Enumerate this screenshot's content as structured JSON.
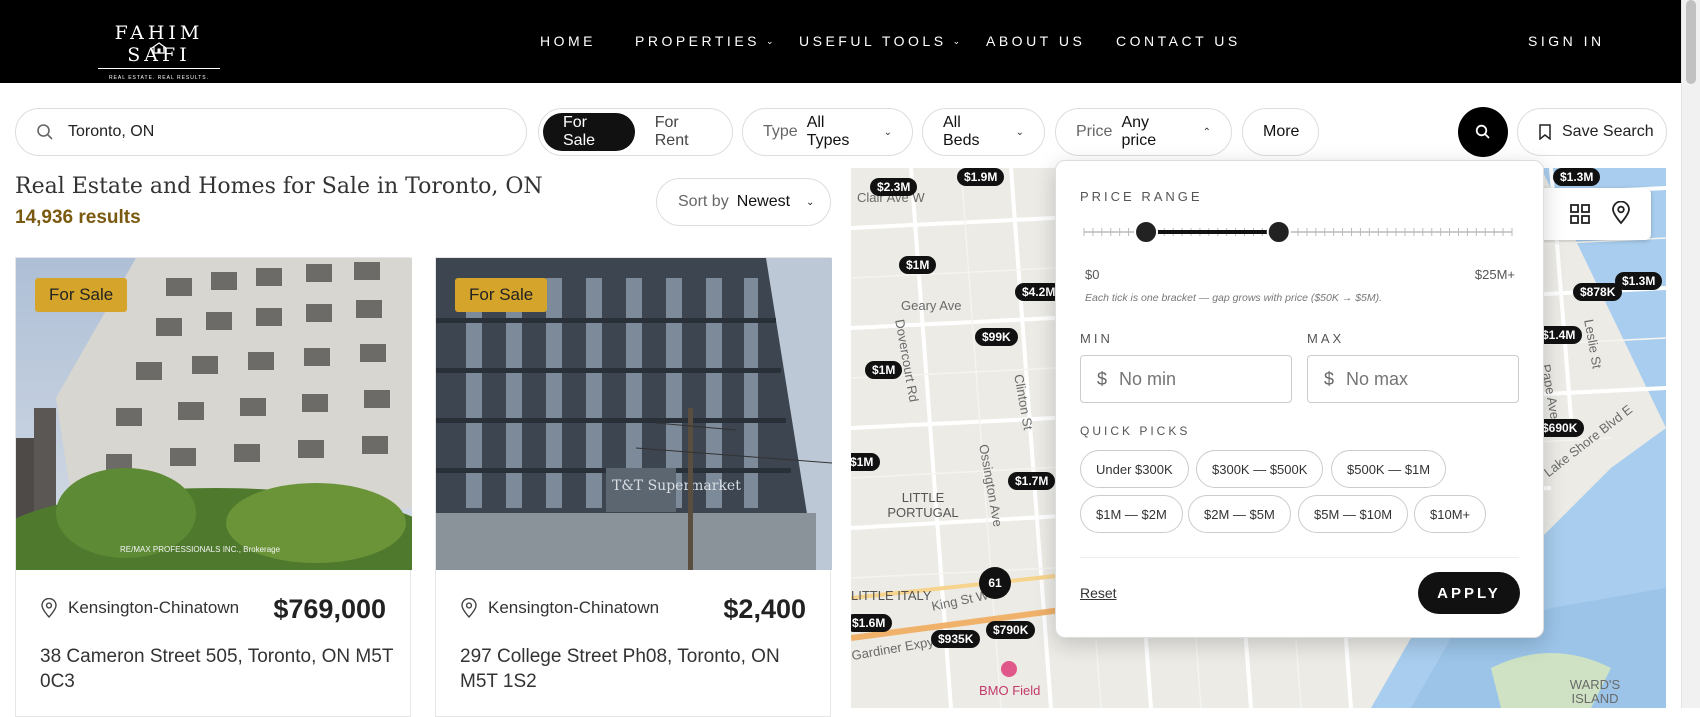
{
  "brand": {
    "name": "FAHIM SAFI",
    "tagline": "REAL ESTATE. REAL RESULTS."
  },
  "nav": {
    "items": [
      {
        "label": "HOME",
        "has_dropdown": false
      },
      {
        "label": "PROPERTIES",
        "has_dropdown": true
      },
      {
        "label": "USEFUL TOOLS",
        "has_dropdown": true
      },
      {
        "label": "ABOUT US",
        "has_dropdown": false
      },
      {
        "label": "CONTACT US",
        "has_dropdown": false
      }
    ],
    "sign_in": "SIGN IN"
  },
  "filters": {
    "location": "Toronto, ON",
    "for_sale": "For Sale",
    "for_rent": "For Rent",
    "active_mode": "For Sale",
    "type_label": "Type",
    "type_value": "All Types",
    "beds_value": "All Beds",
    "price_label": "Price",
    "price_value": "Any price",
    "more": "More",
    "save_search": "Save Search"
  },
  "listing_header": {
    "title": "Real Estate and Homes for Sale in Toronto, ON",
    "results": "14,936 results",
    "sort_label": "Sort by",
    "sort_value": "Newest"
  },
  "listings": [
    {
      "badge": "For Sale",
      "neighbourhood": "Kensington-Chinatown",
      "price": "$769,000",
      "address": "38 Cameron Street 505, Toronto, ON M5T 0C3",
      "photo_watermark": "RE/MAX PROFESSIONALS INC., Brokerage"
    },
    {
      "badge": "For Sale",
      "neighbourhood": "Kensington-Chinatown",
      "price": "$2,400",
      "address": "297 College Street Ph08, Toronto, ON M5T 1S2",
      "photo_watermark": "T&T Supermarket"
    }
  ],
  "map": {
    "markers": [
      "$2.3M",
      "$1.9M",
      "$1M",
      "$4.2M",
      "$99K",
      "$1M",
      "$1M",
      "$1.7M",
      "$1.6M",
      "$935K",
      "$790K",
      "61",
      "$1.3M",
      "$878K",
      "$1.3M",
      "$1.4M",
      "$690K"
    ],
    "labels": [
      "Clair Ave W",
      "Geary Ave",
      "Dovercourt Rd",
      "Clinton St",
      "Ossington Ave",
      "LITTLE PORTUGAL",
      "LITTLE ITALY",
      "King St W",
      "Gardiner Expy",
      "BMO Field",
      "WARD'S ISLAND",
      "Lake Shore Blvd E",
      "Leslie St",
      "Pape Ave"
    ]
  },
  "price_popover": {
    "title": "PRICE RANGE",
    "range_min_label": "$0",
    "range_max_label": "$25M+",
    "hint": "Each tick is one bracket — gap grows with price ($50K → $5M).",
    "min_label": "MIN",
    "max_label": "MAX",
    "currency": "$",
    "min_placeholder": "No min",
    "max_placeholder": "No max",
    "quick_picks_label": "QUICK PICKS",
    "quick_picks": [
      "Under $300K",
      "$300K — $500K",
      "$500K — $1M",
      "$1M — $2M",
      "$2M — $5M",
      "$5M — $10M",
      "$10M+"
    ],
    "reset": "Reset",
    "apply": "APPLY",
    "slider": {
      "low_fraction": 0.145,
      "high_fraction": 0.455,
      "tick_count": 48
    }
  },
  "colors": {
    "accent": "#d4a52a",
    "results": "#7a5a10",
    "nav_bg": "#000000"
  }
}
